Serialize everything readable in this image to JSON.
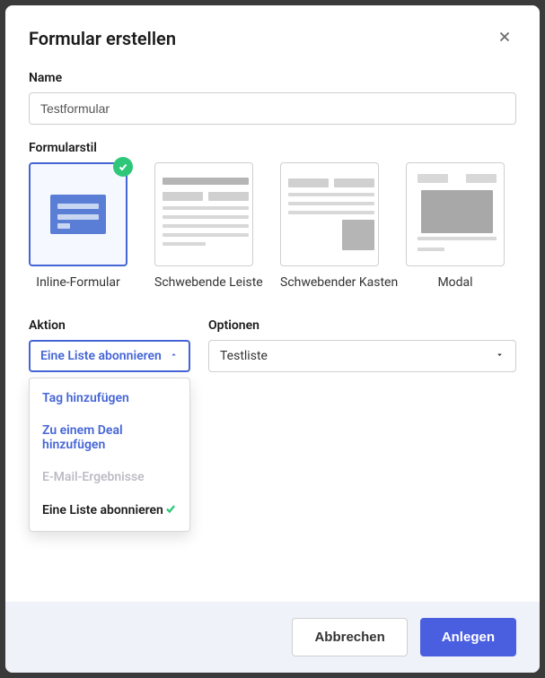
{
  "dialog": {
    "title": "Formular erstellen"
  },
  "name": {
    "label": "Name",
    "value": "Testformular"
  },
  "formStyle": {
    "label": "Formularstil",
    "options": [
      {
        "label": "Inline-Formular",
        "selected": true
      },
      {
        "label": "Schwebende Leiste",
        "selected": false
      },
      {
        "label": "Schwebender Kasten",
        "selected": false
      },
      {
        "label": "Modal",
        "selected": false
      }
    ]
  },
  "action": {
    "label": "Aktion",
    "selected": "Eine Liste abonnieren",
    "open": true,
    "items": [
      {
        "label": "Tag hinzufügen",
        "state": "normal"
      },
      {
        "label": "Zu einem Deal hinzufügen",
        "state": "normal"
      },
      {
        "label": "E-Mail-Ergebnisse",
        "state": "muted"
      },
      {
        "label": "Eine Liste abonnieren",
        "state": "selected"
      }
    ]
  },
  "options": {
    "label": "Optionen",
    "selected": "Testliste"
  },
  "footer": {
    "cancel": "Abbrechen",
    "submit": "Anlegen"
  }
}
